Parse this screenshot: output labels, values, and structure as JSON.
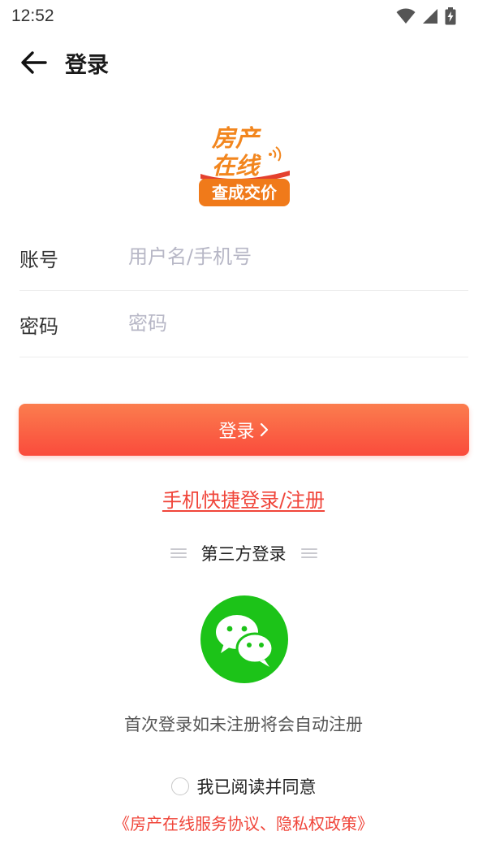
{
  "status_bar": {
    "time": "12:52",
    "icons": [
      "wifi-icon",
      "cell-signal-icon",
      "battery-charging-icon"
    ]
  },
  "header": {
    "title": "登录",
    "back_icon": "arrow-left-icon"
  },
  "logo": {
    "line1": "房产",
    "line2": "在线",
    "banner": "查成交价",
    "colors": {
      "orange": "#f2861e",
      "banner": "#f07a1a",
      "red": "#e4402e"
    }
  },
  "form": {
    "account_label": "账号",
    "account_placeholder": "用户名/手机号",
    "account_value": "",
    "password_label": "密码",
    "password_placeholder": "密码",
    "password_value": ""
  },
  "login_button": {
    "label": "登录",
    "icon": "chevron-right-icon"
  },
  "quick_login": "手机快捷登录/注册",
  "third_party": {
    "label": "第三方登录",
    "wechat_icon": "wechat-icon",
    "wechat_color": "#1cc318"
  },
  "auto_register_note": "首次登录如未注册将会自动注册",
  "agreement": {
    "checked": false,
    "label": "我已阅读并同意",
    "policy_link": "《房产在线服务协议、隐私权政策》"
  },
  "colors": {
    "accent": "#f0453a",
    "button_start": "#fb7d4e",
    "button_end": "#fa4b3c"
  }
}
